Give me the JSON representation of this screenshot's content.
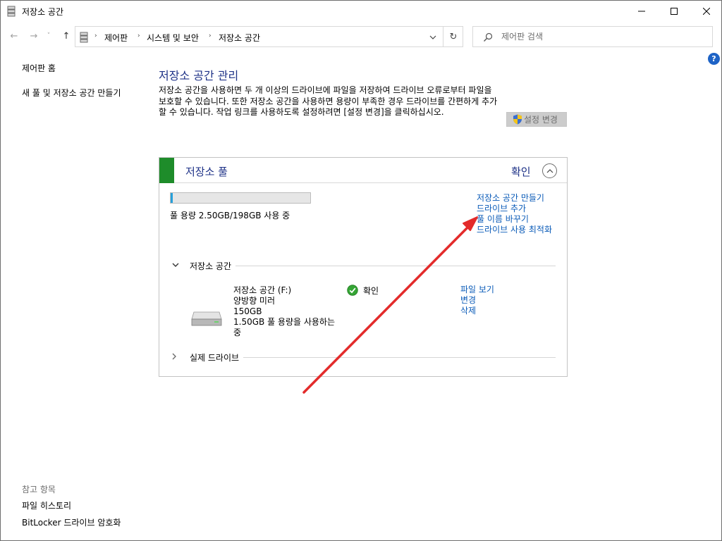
{
  "window": {
    "title": "저장소 공간",
    "minimize": "–",
    "maximize": "□",
    "close": "✕"
  },
  "nav": {
    "back": "←",
    "forward": "→",
    "recent": "˅",
    "up": "↑",
    "breadcrumbs": [
      "제어판",
      "시스템 및 보안",
      "저장소 공간"
    ],
    "separator": "›",
    "dropdown": "⌄",
    "refresh": "↻"
  },
  "search": {
    "placeholder": "제어판 검색"
  },
  "help": "?",
  "leftnav": {
    "home": "제어판 홈",
    "create": "새 풀 및 저장소 공간 만들기",
    "see_also_title": "참고 항목",
    "see_also": [
      "파일 히스토리",
      "BitLocker 드라이브 암호화"
    ]
  },
  "main": {
    "title": "저장소 공간 관리",
    "description": "저장소 공간을 사용하면 두 개 이상의 드라이브에 파일을 저장하여 드라이브 오류로부터 파일을 보호할 수 있습니다. 또한 저장소 공간을 사용하면 용량이 부족한 경우 드라이브를 간편하게 추가할 수 있습니다. 작업 링크를 사용하도록 설정하려면 [설정 변경]을 클릭하십시오.",
    "change_settings": "설정 변경"
  },
  "pool": {
    "title": "저장소 풀",
    "status": "확인",
    "usage_fraction": 0.013,
    "usage_text": "풀 용량 2.50GB/198GB 사용 중",
    "tasks": [
      "저장소 공간 만들기",
      "드라이브 추가",
      "풀 이름 바꾸기",
      "드라이브 사용 최적화"
    ],
    "section_spaces": "저장소 공간",
    "section_drives": "실제 드라이브",
    "space": {
      "name": "저장소 공간 (F:)",
      "resiliency": "양방향 미러",
      "capacity": "150GB",
      "pool_usage": "1.50GB 풀 용량을 사용하는 중",
      "status": "확인",
      "links": [
        "파일 보기",
        "변경",
        "삭제"
      ]
    }
  },
  "colors": {
    "accent_link": "#0a5bb8",
    "heading": "#1e3287",
    "pool_bar": "#1e8c2a",
    "arrow": "#e32b2b"
  }
}
